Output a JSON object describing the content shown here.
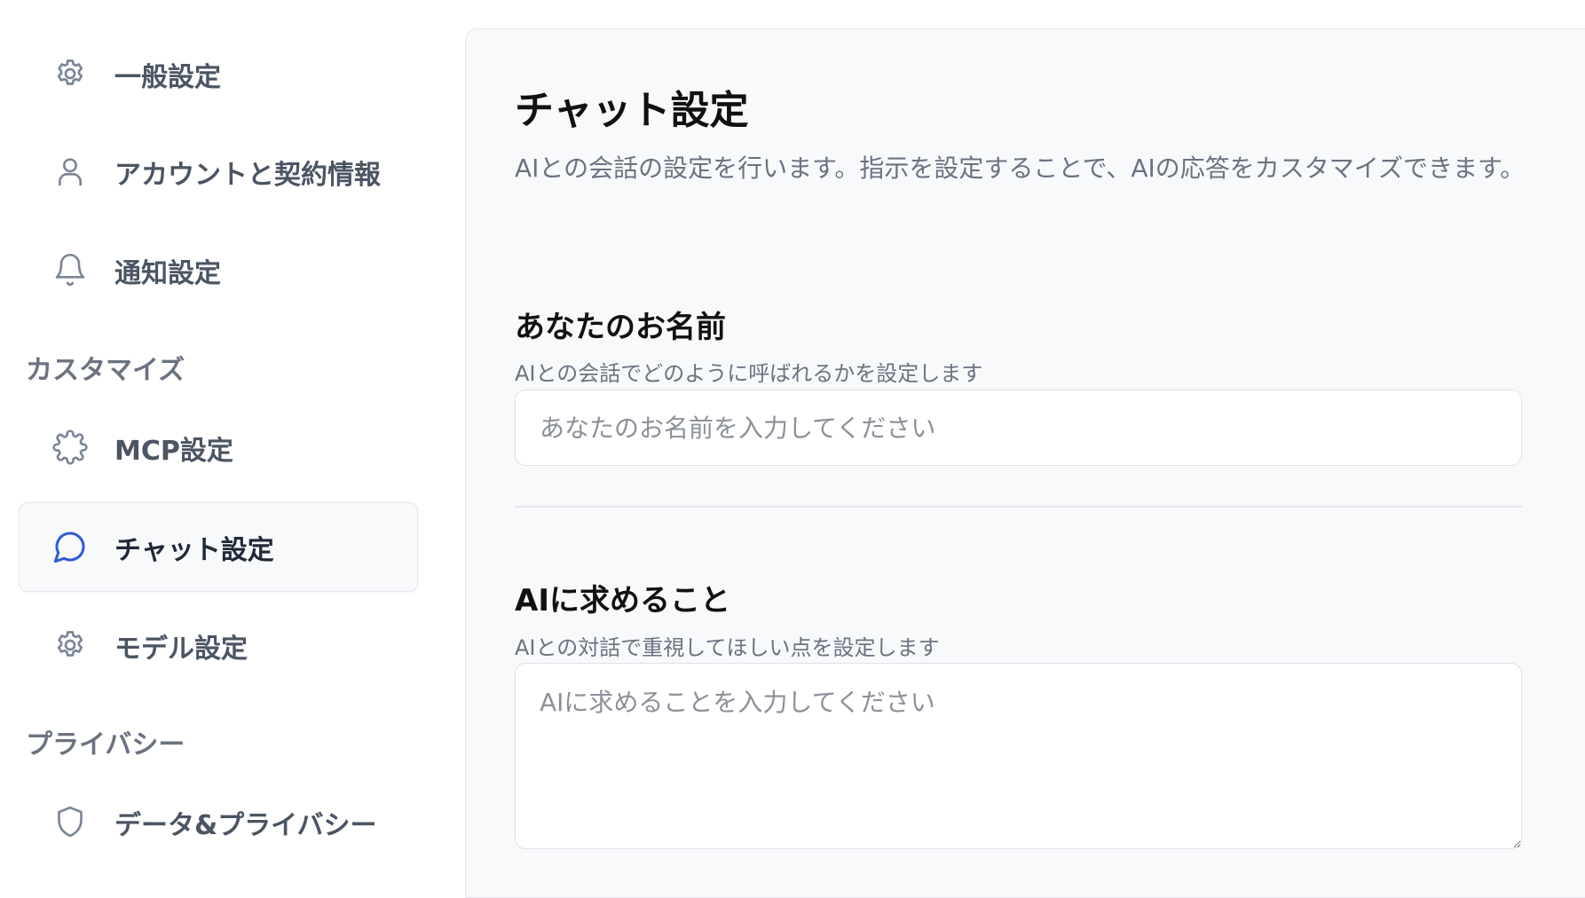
{
  "sidebar": {
    "items": [
      {
        "label": "一般設定",
        "icon": "gear-icon"
      },
      {
        "label": "アカウントと契約情報",
        "icon": "user-icon"
      },
      {
        "label": "通知設定",
        "icon": "bell-icon"
      },
      {
        "label": "MCP設定",
        "icon": "puzzle-icon"
      },
      {
        "label": "チャット設定",
        "icon": "chat-bubble-icon",
        "active": true
      },
      {
        "label": "モデル設定",
        "icon": "gear-icon"
      },
      {
        "label": "データ&プライバシー",
        "icon": "shield-icon"
      }
    ],
    "sections": {
      "customize": "カスタマイズ",
      "privacy": "プライバシー"
    }
  },
  "main": {
    "title": "チャット設定",
    "description": "AIとの会話の設定を行います。指示を設定することで、AIの応答をカスタマイズできます。",
    "name_field": {
      "title": "あなたのお名前",
      "description": "AIとの会話でどのように呼ばれるかを設定します",
      "placeholder": "あなたのお名前を入力してください",
      "value": ""
    },
    "ai_field": {
      "title": "AIに求めること",
      "description": "AIとの対話で重視してほしい点を設定します",
      "placeholder": "AIに求めることを入力してください",
      "value": ""
    }
  },
  "colors": {
    "accent": "#2f5bd3",
    "icon_muted": "#7c8699",
    "panel_bg": "#f8f9fb"
  }
}
